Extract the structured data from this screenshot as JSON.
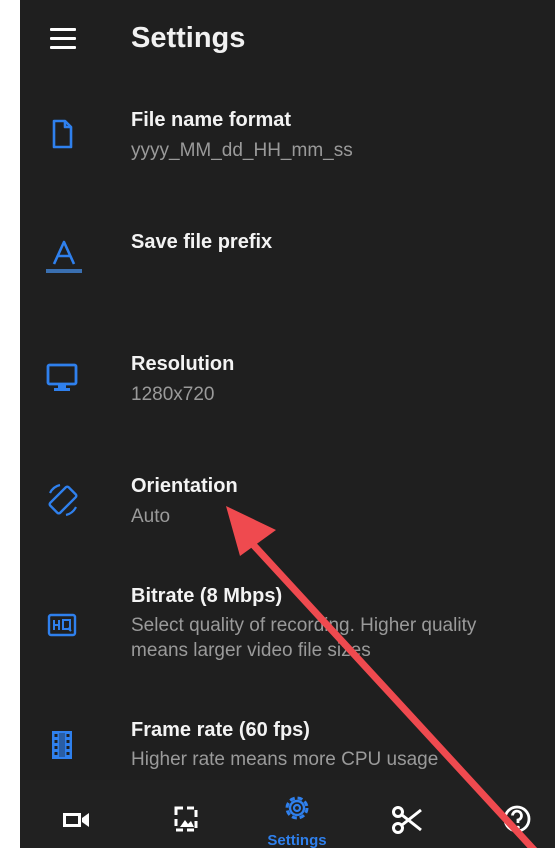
{
  "header": {
    "title": "Settings",
    "menu_icon": "hamburger-menu-icon"
  },
  "settings": [
    {
      "label": "File name format",
      "sub": "yyyy_MM_dd_HH_mm_ss",
      "icon": "file-icon"
    },
    {
      "label": "Save file prefix",
      "sub": "",
      "icon": "text-format-icon"
    },
    {
      "label": "Resolution",
      "sub": "1280x720",
      "icon": "monitor-icon"
    },
    {
      "label": "Orientation",
      "sub": "Auto",
      "icon": "screen-rotation-icon"
    },
    {
      "label": "Bitrate (8 Mbps)",
      "sub": "Select quality of recording. Higher quality means larger video file sizes",
      "icon": "hq-icon"
    },
    {
      "label": "Frame rate (60 fps)",
      "sub": "Higher rate means more CPU usage",
      "icon": "film-icon"
    }
  ],
  "bottom_nav": {
    "active_label": "Settings",
    "items": [
      "video-camera-icon",
      "image-icon",
      "settings-gear-icon",
      "scissors-icon",
      "help-icon"
    ]
  },
  "colors": {
    "background": "#1f1f1f",
    "accent": "#2f80ed",
    "annotation_arrow": "#ef4a4f"
  }
}
